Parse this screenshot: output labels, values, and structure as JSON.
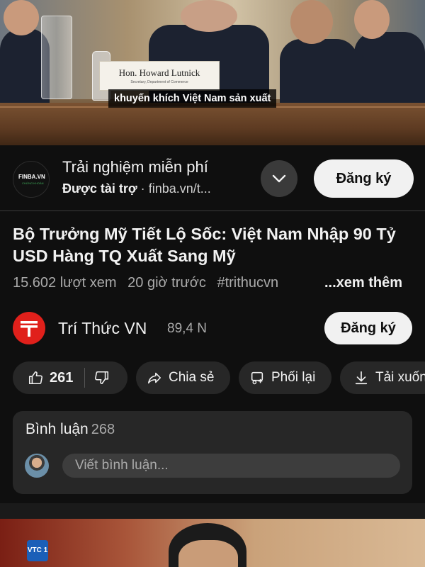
{
  "video": {
    "nameplate_name": "Hon. Howard Lutnick",
    "nameplate_title": "Secretary, Department of Commerce",
    "caption": "khuyến khích Việt Nam sản xuất"
  },
  "ad": {
    "logo_text": "FINBA.VN",
    "logo_sub": "CHỨNG KHOÁN",
    "title": "Trải nghiệm miễn phí",
    "sponsored": "Được tài trợ",
    "dot": "·",
    "domain": "finba.vn/t...",
    "subscribe_label": "Đăng ký"
  },
  "video_info": {
    "title": "Bộ Trưởng Mỹ Tiết Lộ Sốc: Việt Nam Nhập 90 Tỷ USD Hàng TQ Xuất Sang Mỹ",
    "views": "15.602 lượt xem",
    "time": "20 giờ trước",
    "hashtag": "#trithucvn",
    "more": "...xem thêm"
  },
  "channel": {
    "name": "Trí Thức VN",
    "subscribers": "89,4 N",
    "subscribe_label": "Đăng ký"
  },
  "actions": {
    "likes": "261",
    "share": "Chia sẻ",
    "remix": "Phối lại",
    "download": "Tải xuống"
  },
  "comments": {
    "label": "Bình luận",
    "count": "268",
    "placeholder": "Viết bình luận..."
  },
  "next_video": {
    "badge": "VTC 1"
  },
  "colors": {
    "background": "#0f0f0f",
    "chip": "#272727",
    "channel_red": "#e0201b",
    "text_secondary": "#aaaaaa"
  }
}
